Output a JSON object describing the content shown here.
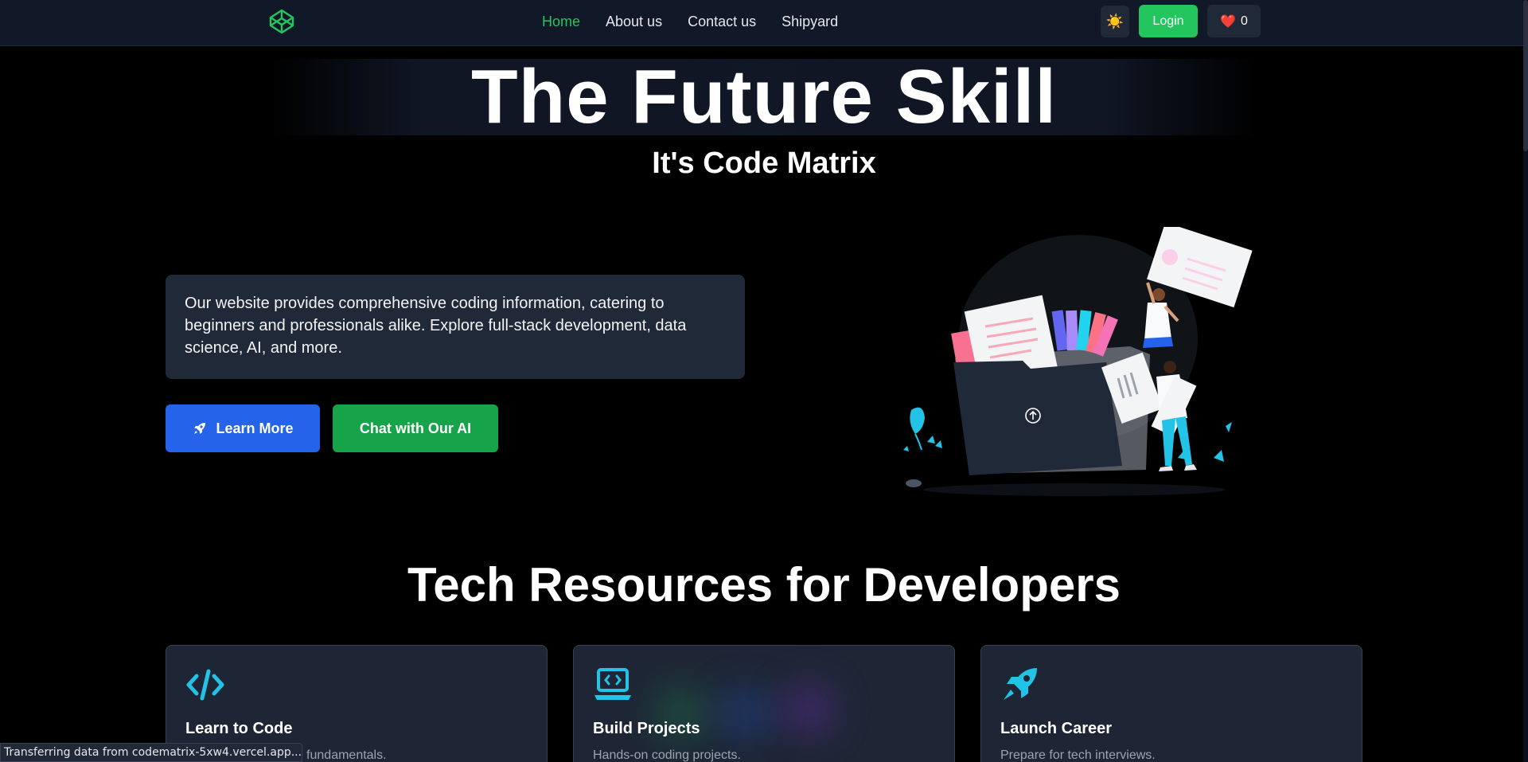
{
  "nav": {
    "links": [
      "Home",
      "About us",
      "Contact us",
      "Shipyard"
    ],
    "active": "Home",
    "theme_icon": "sun-icon",
    "login_label": "Login",
    "likes_icon": "heart-icon",
    "likes_count": "0"
  },
  "hero": {
    "title": "The Future Skill",
    "subtitle": "It's Code Matrix",
    "intro": "Our website provides comprehensive coding information, catering to beginners and professionals alike. Explore full-stack development, data science, AI, and more.",
    "learn_more_label": "Learn More",
    "learn_more_icon": "rocket-icon",
    "chat_label": "Chat with Our AI"
  },
  "resources": {
    "title": "Tech Resources for Developers",
    "cards": [
      {
        "icon": "code-icon",
        "title": "Learn to Code",
        "desc": "Master programming fundamentals."
      },
      {
        "icon": "laptop-code-icon",
        "title": "Build Projects",
        "desc": "Hands-on coding projects."
      },
      {
        "icon": "rocket-icon",
        "title": "Launch Career",
        "desc": "Prepare for tech interviews."
      }
    ]
  },
  "status_bar": "Transferring data from codematrix-5xw4.vercel.app...",
  "colors": {
    "accent_green": "#22c55e",
    "button_blue": "#2563eb",
    "button_green": "#16a34a",
    "icon_cyan": "#22c3e6",
    "card_bg": "#1f2937"
  }
}
